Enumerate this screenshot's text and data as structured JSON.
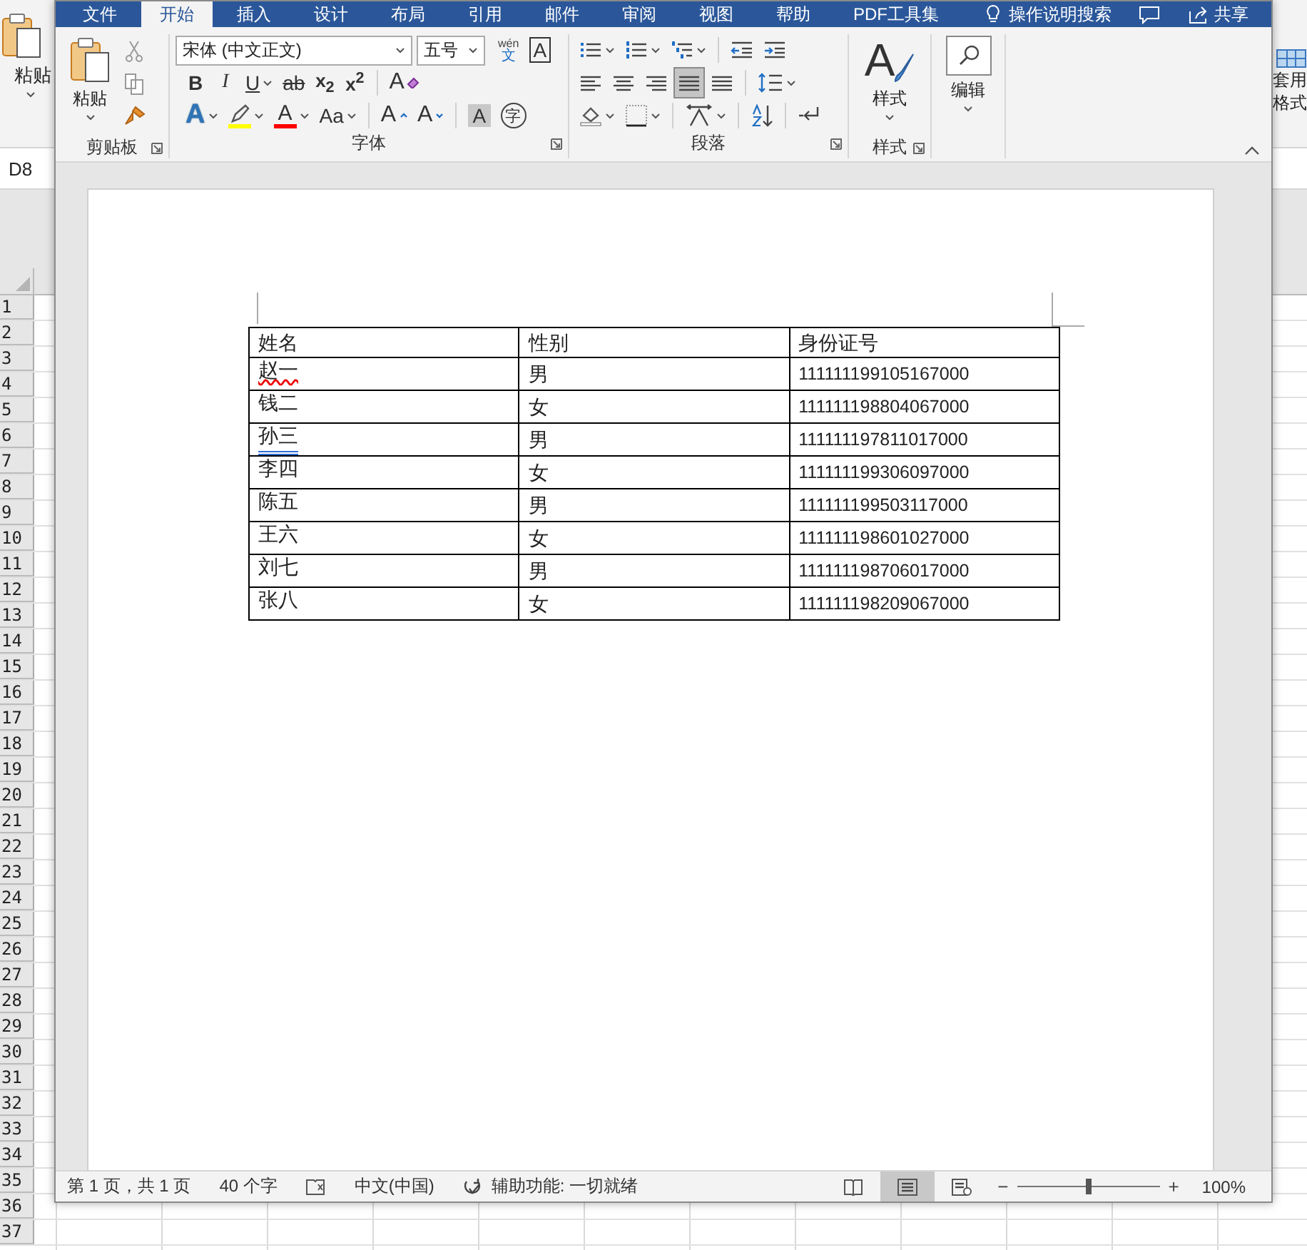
{
  "excel": {
    "paste_label": "粘贴",
    "ribbon_right": [
      "套用",
      "格式"
    ],
    "name_box": "D8",
    "row_numbers": [
      "1",
      "2",
      "3",
      "4",
      "5",
      "6",
      "7",
      "8",
      "9",
      "10",
      "11",
      "12",
      "13",
      "14",
      "15",
      "16",
      "17",
      "18",
      "19",
      "20",
      "21",
      "22",
      "23",
      "24",
      "25",
      "26",
      "27",
      "28",
      "29",
      "30",
      "31",
      "32",
      "33",
      "34",
      "35",
      "36",
      "37"
    ]
  },
  "word": {
    "tabs": [
      {
        "label": "文件",
        "selected": false
      },
      {
        "label": "开始",
        "selected": true
      },
      {
        "label": "插入",
        "selected": false
      },
      {
        "label": "设计",
        "selected": false
      },
      {
        "label": "布局",
        "selected": false
      },
      {
        "label": "引用",
        "selected": false
      },
      {
        "label": "邮件",
        "selected": false
      },
      {
        "label": "审阅",
        "selected": false
      },
      {
        "label": "视图",
        "selected": false
      },
      {
        "label": "帮助",
        "selected": false
      },
      {
        "label": "PDF工具集",
        "selected": false
      }
    ],
    "tell_me": "操作说明搜索",
    "share": "共享",
    "ribbon": {
      "clipboard": {
        "paste": "粘贴",
        "label": "剪贴板"
      },
      "font": {
        "font_name": "宋体 (中文正文)",
        "font_size": "五号",
        "label": "字体",
        "extra_buttons": [
          {
            "kind": "phonetic",
            "label": "文",
            "ruby": "wén"
          },
          {
            "kind": "border",
            "label": "A"
          }
        ],
        "format_buttons": [
          {
            "kind": "bold",
            "label": "B"
          },
          {
            "kind": "italic",
            "label": "I"
          },
          {
            "kind": "underline",
            "label": "U",
            "dropdown": true
          },
          {
            "kind": "strike",
            "label": "ab"
          },
          {
            "kind": "subscript",
            "label": "x$_{2}$"
          },
          {
            "kind": "superscript",
            "label": "x$^{2}$"
          },
          {
            "kind": "clear",
            "label": "A"
          }
        ],
        "effect_buttons": [
          {
            "kind": "text_effect",
            "label": "A",
            "dropdown": true
          },
          {
            "kind": "highlight",
            "dropdown": true,
            "color": "#ffff00"
          },
          {
            "kind": "font_color",
            "label": "A",
            "dropdown": true,
            "color": "#ff0000"
          },
          {
            "kind": "change_case",
            "label": "Aa",
            "dropdown": true
          },
          {
            "kind": "grow",
            "label": "A"
          },
          {
            "kind": "shrink",
            "label": "A"
          },
          {
            "kind": "shading",
            "label": "A"
          },
          {
            "kind": "enclose",
            "label": "字"
          }
        ]
      },
      "paragraph": {
        "label": "段落",
        "alignment": [
          {
            "kind": "left",
            "selected": false
          },
          {
            "kind": "center",
            "selected": false
          },
          {
            "kind": "right",
            "selected": false
          },
          {
            "kind": "justify",
            "selected": true
          },
          {
            "kind": "distributed",
            "selected": false
          }
        ]
      },
      "styles": {
        "icon_label": "A",
        "button": "样式",
        "label": "样式"
      },
      "editing": {
        "button": "编辑"
      }
    },
    "table": {
      "columns": [
        "姓名",
        "性别",
        "身份证号"
      ],
      "rows": [
        {
          "cells": [
            "赵一",
            "男",
            "111111199105167000"
          ],
          "spelling_error": true,
          "grammar_error": false
        },
        {
          "cells": [
            "钱二",
            "女",
            "111111198804067000"
          ],
          "spelling_error": false,
          "grammar_error": false
        },
        {
          "cells": [
            "孙三",
            "男",
            "111111197811017000"
          ],
          "spelling_error": false,
          "grammar_error": true
        },
        {
          "cells": [
            "李四",
            "女",
            "111111199306097000"
          ],
          "spelling_error": false,
          "grammar_error": false
        },
        {
          "cells": [
            "陈五",
            "男",
            "111111199503117000"
          ],
          "spelling_error": false,
          "grammar_error": false
        },
        {
          "cells": [
            "王六",
            "女",
            "111111198601027000"
          ],
          "spelling_error": false,
          "grammar_error": false
        },
        {
          "cells": [
            "刘七",
            "男",
            "111111198706017000"
          ],
          "spelling_error": false,
          "grammar_error": false
        },
        {
          "cells": [
            "张八",
            "女",
            "111111198209067000"
          ],
          "spelling_error": false,
          "grammar_error": false
        }
      ]
    },
    "status_bar": {
      "page": "第 1 页，共 1 页",
      "words": "40 个字",
      "language": "中文(中国)",
      "accessibility": "辅助功能: 一切就绪",
      "views": [
        {
          "kind": "read",
          "selected": false
        },
        {
          "kind": "print",
          "selected": true
        },
        {
          "kind": "web",
          "selected": false
        }
      ],
      "zoom": {
        "out": "−",
        "in": "+",
        "level": 0.5,
        "reading": "100%"
      }
    }
  }
}
